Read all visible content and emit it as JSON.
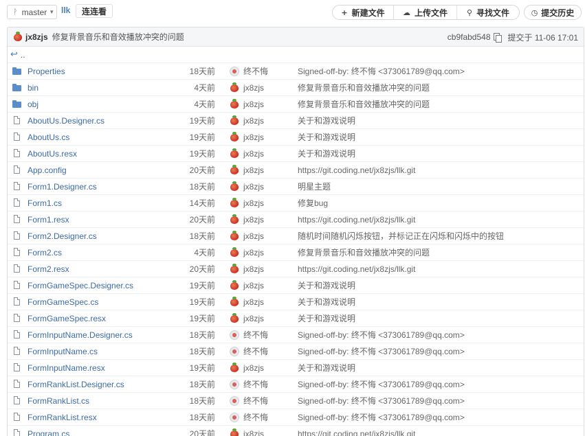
{
  "toolbar": {
    "branch": "master",
    "repo": "llk",
    "path": "连连看",
    "new_file": "新建文件",
    "upload_file": "上传文件",
    "find_file": "寻找文件",
    "history": "提交历史"
  },
  "commit": {
    "author": "jx8zjs",
    "message": "修复背景音乐和音效播放冲突的问题",
    "sha": "cb9fabd548",
    "date": "提交于 11-06 17:01"
  },
  "up_label": "..",
  "files": [
    {
      "type": "folder",
      "name": "Properties",
      "age": "18天前",
      "avatar": "pale",
      "user": "终不悔",
      "msg": "Signed-off-by: 终不悔 <373061789@qq.com>"
    },
    {
      "type": "folder",
      "name": "bin",
      "age": "4天前",
      "avatar": "red",
      "user": "jx8zjs",
      "msg": "修复背景音乐和音效播放冲突的问题"
    },
    {
      "type": "folder",
      "name": "obj",
      "age": "4天前",
      "avatar": "red",
      "user": "jx8zjs",
      "msg": "修复背景音乐和音效播放冲突的问题"
    },
    {
      "type": "file",
      "name": "AboutUs.Designer.cs",
      "age": "19天前",
      "avatar": "red",
      "user": "jx8zjs",
      "msg": "关于和游戏说明"
    },
    {
      "type": "file",
      "name": "AboutUs.cs",
      "age": "19天前",
      "avatar": "red",
      "user": "jx8zjs",
      "msg": "关于和游戏说明"
    },
    {
      "type": "file",
      "name": "AboutUs.resx",
      "age": "19天前",
      "avatar": "red",
      "user": "jx8zjs",
      "msg": "关于和游戏说明"
    },
    {
      "type": "file",
      "name": "App.config",
      "age": "20天前",
      "avatar": "red",
      "user": "jx8zjs",
      "msg": "https://git.coding.net/jx8zjs/llk.git"
    },
    {
      "type": "file",
      "name": "Form1.Designer.cs",
      "age": "18天前",
      "avatar": "red",
      "user": "jx8zjs",
      "msg": "明星主题"
    },
    {
      "type": "file",
      "name": "Form1.cs",
      "age": "14天前",
      "avatar": "red",
      "user": "jx8zjs",
      "msg": "修复bug"
    },
    {
      "type": "file",
      "name": "Form1.resx",
      "age": "20天前",
      "avatar": "red",
      "user": "jx8zjs",
      "msg": "https://git.coding.net/jx8zjs/llk.git"
    },
    {
      "type": "file",
      "name": "Form2.Designer.cs",
      "age": "18天前",
      "avatar": "red",
      "user": "jx8zjs",
      "msg": "随机时间随机闪烁按钮，并标记正在闪烁和闪烁中的按钮"
    },
    {
      "type": "file",
      "name": "Form2.cs",
      "age": "4天前",
      "avatar": "red",
      "user": "jx8zjs",
      "msg": "修复背景音乐和音效播放冲突的问题"
    },
    {
      "type": "file",
      "name": "Form2.resx",
      "age": "20天前",
      "avatar": "red",
      "user": "jx8zjs",
      "msg": "https://git.coding.net/jx8zjs/llk.git"
    },
    {
      "type": "file",
      "name": "FormGameSpec.Designer.cs",
      "age": "19天前",
      "avatar": "red",
      "user": "jx8zjs",
      "msg": "关于和游戏说明"
    },
    {
      "type": "file",
      "name": "FormGameSpec.cs",
      "age": "19天前",
      "avatar": "red",
      "user": "jx8zjs",
      "msg": "关于和游戏说明"
    },
    {
      "type": "file",
      "name": "FormGameSpec.resx",
      "age": "19天前",
      "avatar": "red",
      "user": "jx8zjs",
      "msg": "关于和游戏说明"
    },
    {
      "type": "file",
      "name": "FormInputName.Designer.cs",
      "age": "18天前",
      "avatar": "pale",
      "user": "终不悔",
      "msg": "Signed-off-by: 终不悔 <373061789@qq.com>"
    },
    {
      "type": "file",
      "name": "FormInputName.cs",
      "age": "18天前",
      "avatar": "pale",
      "user": "终不悔",
      "msg": "Signed-off-by: 终不悔 <373061789@qq.com>"
    },
    {
      "type": "file",
      "name": "FormInputName.resx",
      "age": "19天前",
      "avatar": "red",
      "user": "jx8zjs",
      "msg": "关于和游戏说明"
    },
    {
      "type": "file",
      "name": "FormRankList.Designer.cs",
      "age": "18天前",
      "avatar": "pale",
      "user": "终不悔",
      "msg": "Signed-off-by: 终不悔 <373061789@qq.com>"
    },
    {
      "type": "file",
      "name": "FormRankList.cs",
      "age": "18天前",
      "avatar": "pale",
      "user": "终不悔",
      "msg": "Signed-off-by: 终不悔 <373061789@qq.com>"
    },
    {
      "type": "file",
      "name": "FormRankList.resx",
      "age": "18天前",
      "avatar": "pale",
      "user": "终不悔",
      "msg": "Signed-off-by: 终不悔 <373061789@qq.com>"
    },
    {
      "type": "file",
      "name": "Program.cs",
      "age": "20天前",
      "avatar": "red",
      "user": "jx8zjs",
      "msg": "https://git.coding.net/jx8zjs/llk.git"
    }
  ]
}
